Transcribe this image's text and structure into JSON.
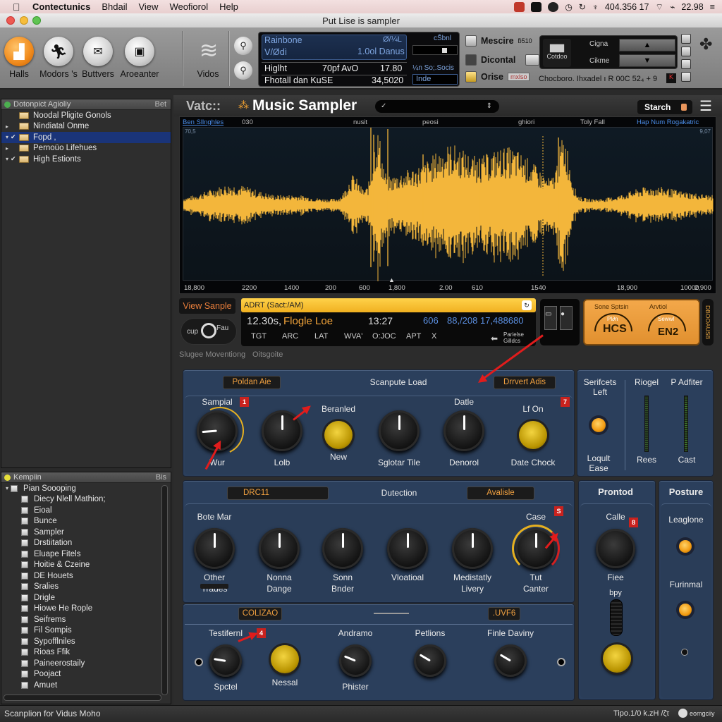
{
  "menubar": {
    "items": [
      "Contectunics",
      "Bhdail",
      "View",
      "Weofiorol",
      "Help"
    ],
    "clock_text": "404.356 17",
    "time": "22.98"
  },
  "window": {
    "title": "Put Lise is sampler"
  },
  "toolbar": {
    "buttons": [
      {
        "label": "Halls",
        "icon": "halls-icon"
      },
      {
        "label": "Modors 's",
        "icon": "runner-icon"
      },
      {
        "label": "Buttvers",
        "icon": "envelope-icon"
      },
      {
        "label": "Aroeanter",
        "icon": "bag-icon"
      },
      {
        "label": "Vidos",
        "icon": "video-icon"
      }
    ],
    "lcd": {
      "row1_left": "Rainbone",
      "row1_right": "Ø/¼L",
      "row2_left": "Ⅴ/Ødì",
      "row2_right": "1.0ol Danus",
      "row3_left": "Higlht",
      "row3_mid": "70pf AvO",
      "row3_right": "17.80",
      "row4_left": "Fhotall dan KuSE",
      "row4_right": "34,5020",
      "side_top": "cŠbnl",
      "side_mid": "¼n So;.Socis",
      "side_input": "Inde"
    },
    "mid": {
      "row1": "Mescire",
      "row1_small": "ƃ510",
      "row2": "Dicontal",
      "row3": "Orise",
      "row3_small": "mxlso",
      "readout": "Chocboro. Ihxadel ı R 00C 52₄ + 9"
    },
    "updown": {
      "left_label": "Cotdoo",
      "up_label": "Cigna",
      "down_label": "Cikme"
    }
  },
  "left_top_panel": {
    "header": "Dotonpict Agioliy",
    "header_right": "Bet",
    "items": [
      {
        "label": "Noodal Pligite Gonols",
        "expand": "",
        "checked": false,
        "selected": false
      },
      {
        "label": "Nindiatal Onme",
        "expand": "▸",
        "checked": false,
        "selected": false
      },
      {
        "label": "Fopd ,",
        "expand": "▾",
        "checked": true,
        "selected": true
      },
      {
        "label": "Pernoüo Lifehues",
        "expand": "▸",
        "checked": false,
        "selected": false
      },
      {
        "label": "High Estionts",
        "expand": "▾",
        "checked": true,
        "selected": false
      }
    ]
  },
  "left_bottom_panel": {
    "header": "Kempiin",
    "header_right": "Bis",
    "root": "Pian Soooping",
    "items": [
      "Diecy Nlell Mathion;",
      "Eioal",
      "Bunce",
      "Sampler",
      "Drstiitation",
      "Eluape Fitels",
      "Hoitie & Czeine",
      "DE Houets",
      "Sralies",
      "Drigle",
      "Hiowe He Rople",
      "Seifrems",
      "Fil Sompis",
      "Sypofflniles",
      "Rioas Ffik",
      "Paineerostaily",
      "Poojact",
      "Amuet"
    ]
  },
  "main": {
    "prefix": "Vatc::",
    "title": "Music Sampler",
    "title_field": "✓",
    "search_button": "Starch",
    "wave_tabs": [
      "Ben Sllnghles",
      "030",
      "nusit",
      "peosi",
      "ghiori",
      "Toly Fall",
      "Hap Num Rogakatric"
    ],
    "wave_corner_left": "70,5",
    "wave_corner_right": "9,07",
    "ruler": [
      "18,800",
      "2200",
      "1400",
      "200",
      "600",
      "1,800",
      "2.00",
      "610",
      "1540",
      "18,900",
      "10000",
      "2,900"
    ],
    "view_sample": "View Sanple",
    "file_bar": "ADRT (Sact:/AM)",
    "readout_time": "12.30s,",
    "readout_name": "Flogle Loe",
    "readout_pos": "13:27",
    "readout_num": "606",
    "readout_range": "88,/208 17,488680",
    "transport": [
      "TGT",
      "ARC",
      "LAT",
      "WVA'",
      "O:JOC",
      "APT",
      "X"
    ],
    "transport_right": "Parielse Gilldcs",
    "pitch_left": "cup",
    "pitch_right": "Fau",
    "substatus": "Slugee Moventiong",
    "substatus2": "Oitsgoite",
    "orange_panel": {
      "left_title": "Sone Sptsin",
      "left_value": "HCS",
      "left_inner": "Pl∂n",
      "right_title": "Arvtiol",
      "right_value": "EN2",
      "right_inner": "Sewwl",
      "side_label": "DBOOAUSB"
    }
  },
  "section1": {
    "left_tag": "Poldan Aie",
    "title": "Scanpute Load",
    "right_tag": "Drrvert Adis",
    "controls": [
      {
        "label": "Sampial",
        "bottom": "Wur",
        "type": "knob",
        "badge": "1",
        "value": 0.15
      },
      {
        "label": "",
        "bottom": "Lolb",
        "type": "knob",
        "value": 0.5
      },
      {
        "label": "Beranled",
        "bottom": "New",
        "type": "button"
      },
      {
        "label": "",
        "bottom": "Sglotar Tile",
        "type": "knob",
        "value": 0.5
      },
      {
        "label": "Datle",
        "bottom": "Denorol",
        "type": "knob",
        "value": 0.5
      },
      {
        "label": "Lf On",
        "bottom": "Date Chock",
        "type": "button",
        "badge": "7"
      }
    ]
  },
  "section1_right": {
    "col1_top": "Serifcets Left",
    "col1_bottom": "Loqult Ease",
    "col2_top": "Riogel",
    "col2_bottom": "Rees",
    "col2_level": 0.35,
    "col3_top": "P Adfiter",
    "col3_bottom": "Cast",
    "col3_level": 0.55
  },
  "section2": {
    "left_tag": "DRC11",
    "title": "Dutection",
    "right_tag": "Avalisle",
    "controls": [
      {
        "label": "Bote Mar",
        "bottom": "Other",
        "bottom2": "Trades",
        "value": 0.5
      },
      {
        "label": "",
        "bottom": "Nonna",
        "bottom2": "Dange",
        "value": 0.5
      },
      {
        "label": "",
        "bottom": "Sonn",
        "bottom2": "Bnder",
        "value": 0.5
      },
      {
        "label": "",
        "bottom": "Vloatioal",
        "bottom2": "",
        "value": 0.5
      },
      {
        "label": "",
        "bottom": "Medistatly",
        "bottom2": "Livery",
        "value": 0.5
      },
      {
        "label": "Case",
        "bottom": "Tut",
        "bottom2": "Canter",
        "value": 0.5,
        "badge": "S"
      }
    ]
  },
  "section3": {
    "left_tag": "COLIZAO",
    "right_tag": ".UVF6",
    "controls": [
      {
        "label": "Testifernl",
        "bottom": "Spctel",
        "type": "knob",
        "badge": "4",
        "value": 0.2
      },
      {
        "label": "",
        "bottom": "Nessal",
        "type": "button"
      },
      {
        "label": "Andramo",
        "bottom": "Phister",
        "type": "knob",
        "value": 0.25
      },
      {
        "label": "Petlions",
        "bottom": "",
        "type": "knob",
        "value": 0.28
      },
      {
        "label": "Finle Daviny",
        "bottom": "",
        "type": "knob",
        "value": 0.28
      }
    ]
  },
  "prontod": {
    "title": "Prontod",
    "knob_label": "Calle",
    "badge": "8",
    "knob_bottom": "Fiee",
    "slider_label": "bpy"
  },
  "posture": {
    "title": "Posture",
    "led1": "Leaglone",
    "led2": "Furinmal"
  },
  "status": {
    "left": "Scanplion for Vidus Moho",
    "right": "Tipo.1/0 k.zH /ζτ",
    "right2": "eomgciiy"
  }
}
